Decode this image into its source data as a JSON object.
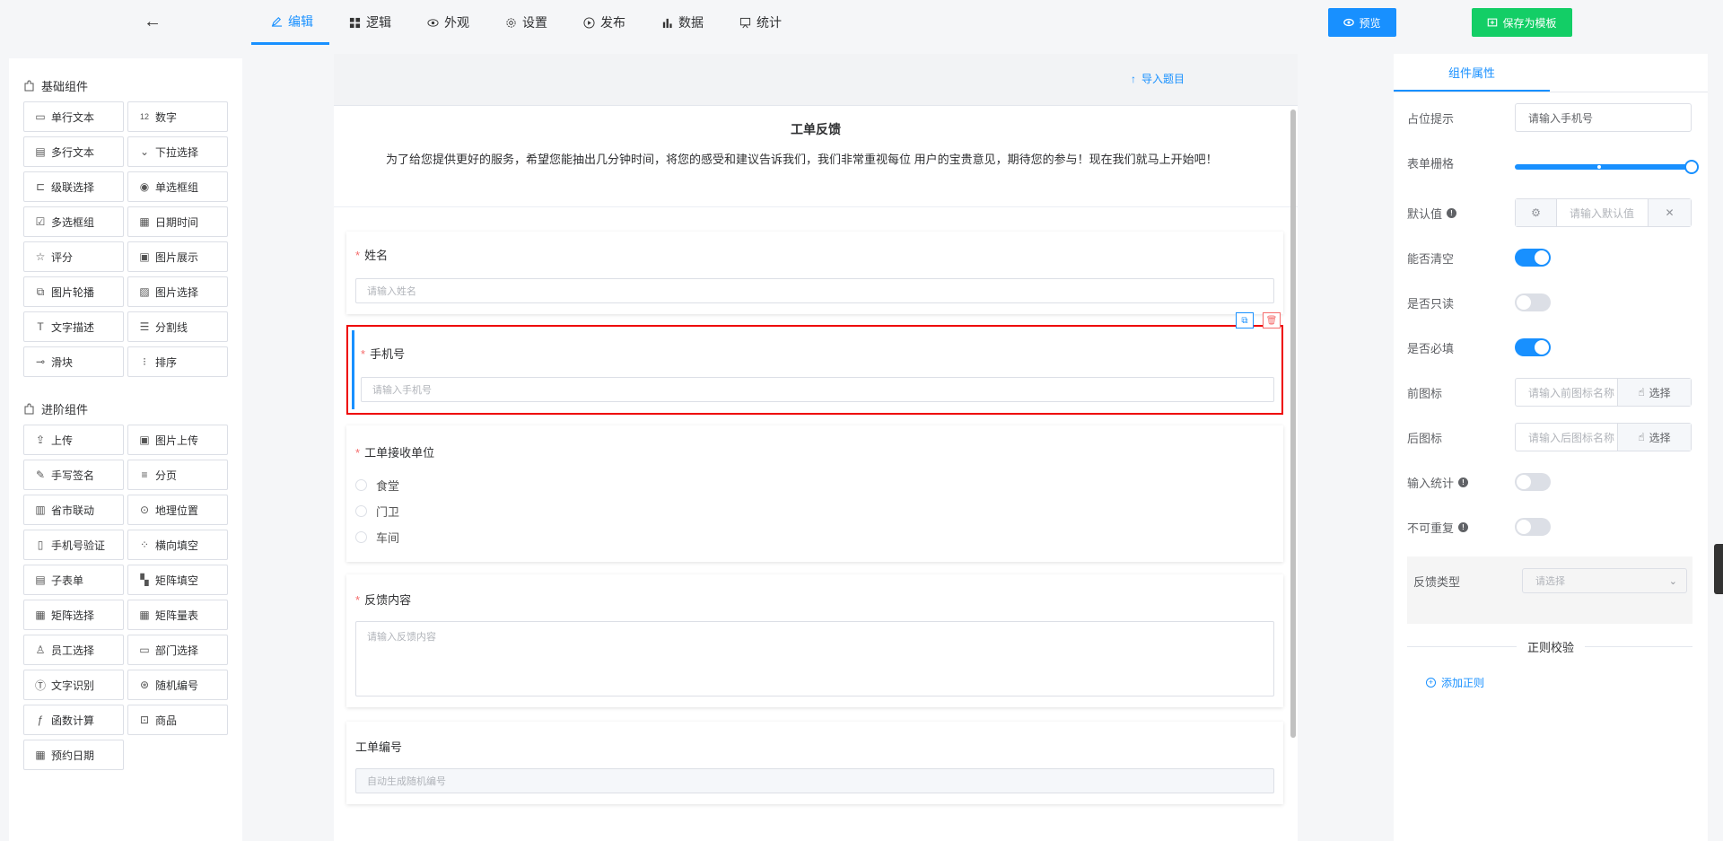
{
  "topbar": {
    "tabs": [
      {
        "label": "编辑",
        "icon": "edit-icon"
      },
      {
        "label": "逻辑",
        "icon": "grid-icon"
      },
      {
        "label": "外观",
        "icon": "eye-icon"
      },
      {
        "label": "设置",
        "icon": "gear-icon"
      },
      {
        "label": "发布",
        "icon": "play-icon"
      },
      {
        "label": "数据",
        "icon": "bar-chart-icon"
      },
      {
        "label": "统计",
        "icon": "stats-icon"
      }
    ],
    "preview_label": "预览",
    "save_template_label": "保存为模板"
  },
  "left": {
    "basic_title": "基础组件",
    "basic": [
      "单行文本",
      "数字",
      "多行文本",
      "下拉选择",
      "级联选择",
      "单选框组",
      "多选框组",
      "日期时间",
      "评分",
      "图片展示",
      "图片轮播",
      "图片选择",
      "文字描述",
      "分割线",
      "滑块",
      "排序"
    ],
    "advanced_title": "进阶组件",
    "advanced": [
      "上传",
      "图片上传",
      "手写签名",
      "分页",
      "省市联动",
      "地理位置",
      "手机号验证",
      "横向填空",
      "子表单",
      "矩阵填空",
      "矩阵选择",
      "矩阵量表",
      "员工选择",
      "部门选择",
      "文字识别",
      "随机编号",
      "函数计算",
      "商品",
      "预约日期"
    ]
  },
  "canvas": {
    "import_label": "导入题目",
    "title": "工单反馈",
    "description": "为了给您提供更好的服务，希望您能抽出几分钟时间，将您的感受和建议告诉我们，我们非常重视每位 用户的宝贵意见，期待您的参与！现在我们就马上开始吧！",
    "fields": {
      "name": {
        "label": "姓名",
        "placeholder": "请输入姓名"
      },
      "phone": {
        "label": "手机号",
        "placeholder": "请输入手机号"
      },
      "unit": {
        "label": "工单接收单位",
        "options": [
          "食堂",
          "门卫",
          "车间"
        ]
      },
      "feedback": {
        "label": "反馈内容",
        "placeholder": "请输入反馈内容"
      },
      "number": {
        "label": "工单编号",
        "placeholder": "自动生成随机编号"
      }
    }
  },
  "props": {
    "tab": "组件属性",
    "placeholder_label": "占位提示",
    "placeholder_value": "请输入手机号",
    "grid_label": "表单栅格",
    "grid_value": 1.0,
    "default_label": "默认值",
    "default_placeholder": "请输入默认值",
    "clearable_label": "能否清空",
    "readonly_label": "是否只读",
    "required_label": "是否必填",
    "prefix_label": "前图标",
    "prefix_placeholder": "请输入前图标名称",
    "suffix_label": "后图标",
    "suffix_placeholder": "请输入后图标名称",
    "choose_label": "选择",
    "count_label": "输入统计",
    "unique_label": "不可重复",
    "feedback_type_label": "反馈类型",
    "feedback_type_placeholder": "请选择",
    "rules_title": "正则校验",
    "add_rule_label": "添加正则"
  },
  "colors": {
    "primary": "#1890ff",
    "success": "#13ce66",
    "danger": "#f56c6c",
    "selection": "#e00000"
  }
}
